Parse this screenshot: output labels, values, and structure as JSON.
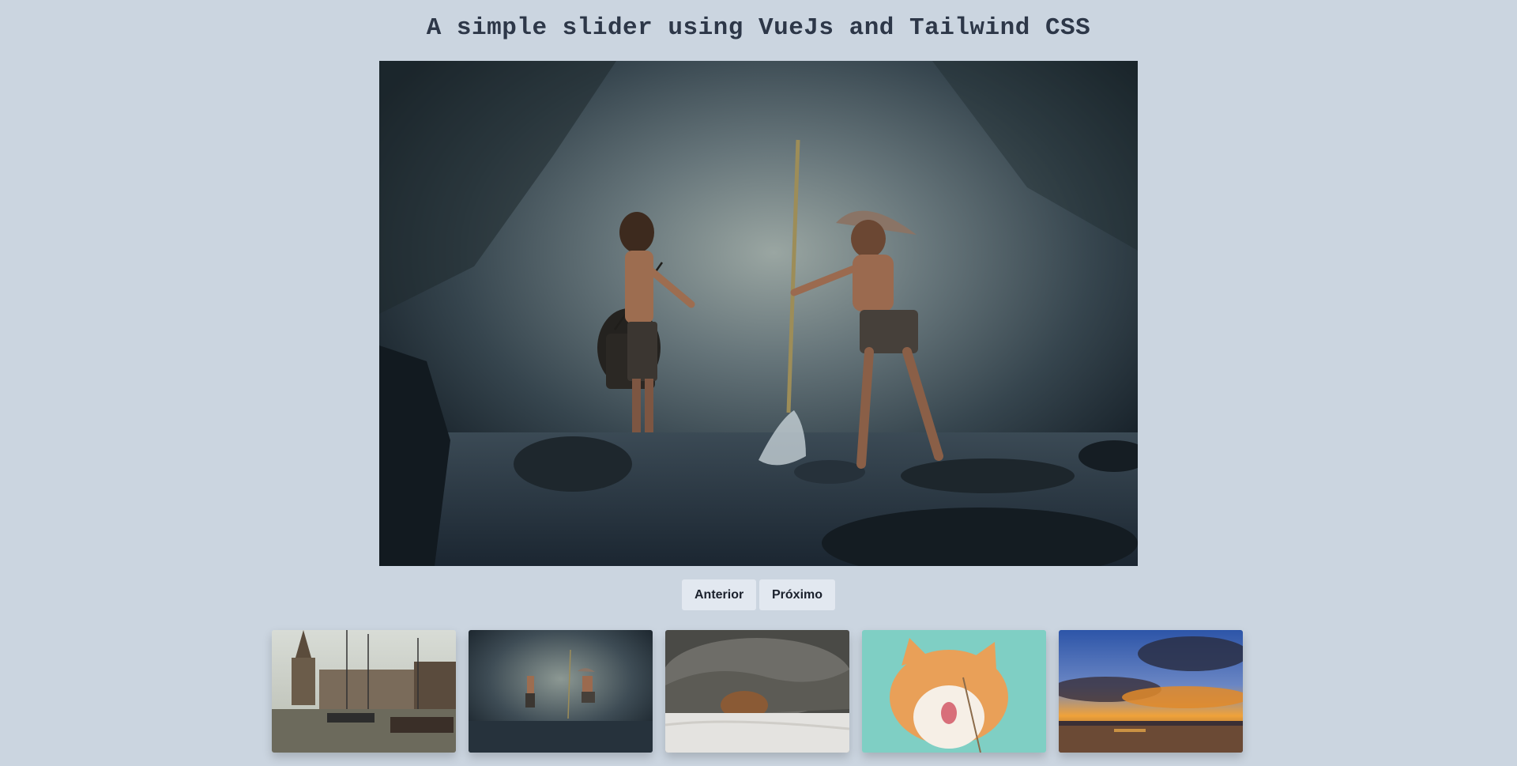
{
  "page": {
    "title": "A simple slider using VueJs and Tailwind CSS"
  },
  "controls": {
    "prev_label": "Anterior",
    "next_label": "Próximo"
  },
  "colors": {
    "background": "#cbd5e0",
    "button_bg": "#e2e8f0",
    "title_color": "#2d3748"
  },
  "slider": {
    "active_index": 1,
    "main_image": "boys-fishing-in-river-photo",
    "thumbnails": [
      {
        "image": "harbor-boats-town-photo"
      },
      {
        "image": "boys-fishing-in-river-photo"
      },
      {
        "image": "dog-under-blanket-photo"
      },
      {
        "image": "orange-cat-licking-photo"
      },
      {
        "image": "sunset-clouds-lake-photo"
      }
    ]
  }
}
